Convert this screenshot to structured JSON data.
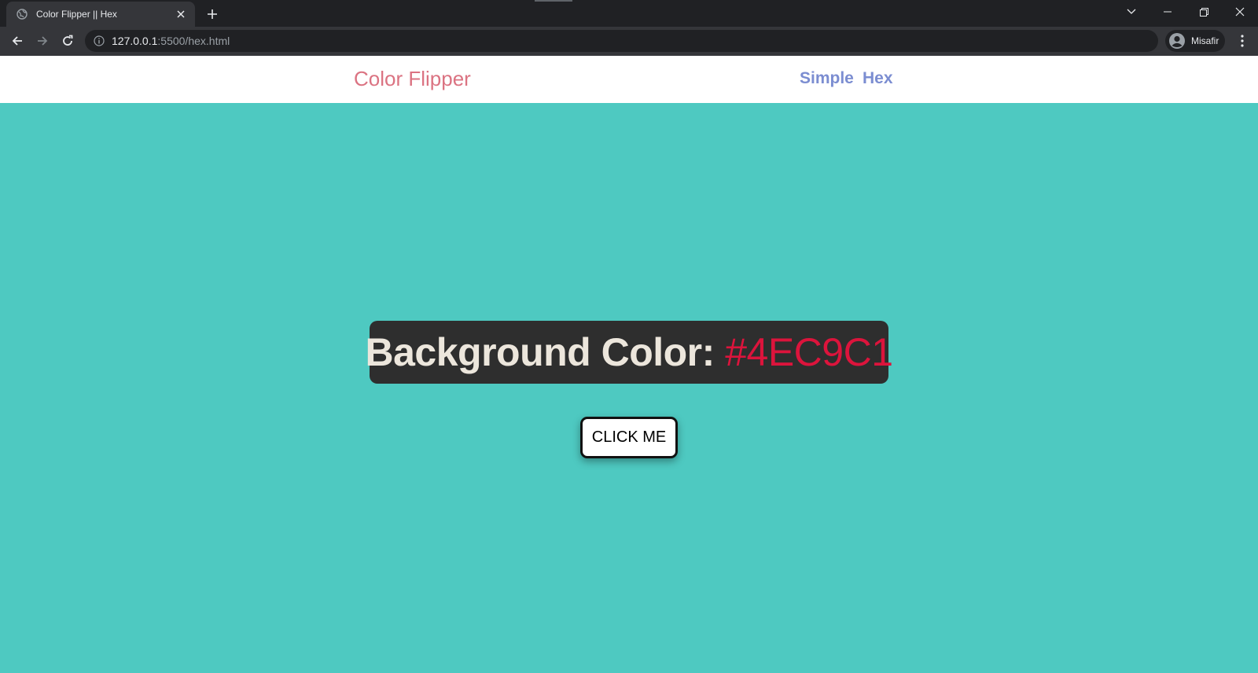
{
  "browser": {
    "tab_title": "Color Flipper || Hex",
    "url_host": "127.0.0.1",
    "url_rest": ":5500/hex.html",
    "profile_label": "Misafir",
    "icons": {
      "favicon": "globe-icon",
      "tab_close": "close-icon",
      "new_tab": "plus-icon",
      "tab_search": "chevron-down-icon",
      "minimize": "minimize-icon",
      "restore": "restore-icon",
      "close_window": "close-icon",
      "back": "back-arrow-icon",
      "forward": "forward-arrow-icon",
      "reload": "reload-icon",
      "site_info": "info-icon",
      "avatar": "avatar-icon",
      "menu": "kebab-menu-icon"
    }
  },
  "page": {
    "brand": "Color Flipper",
    "nav_links": [
      {
        "label": "Simple"
      },
      {
        "label": "Hex"
      }
    ],
    "heading_label": "Background Color:",
    "color_value": "#4EC9C1",
    "button_label": "CLICK ME"
  },
  "colors": {
    "page_background": "#4EC9C1",
    "brand_text": "#DB7382",
    "nav_link_text": "#7B8DD1",
    "color_value_text": "#DC143C",
    "heading_box": "#2E2E2E",
    "heading_text": "#ECE6DC"
  }
}
